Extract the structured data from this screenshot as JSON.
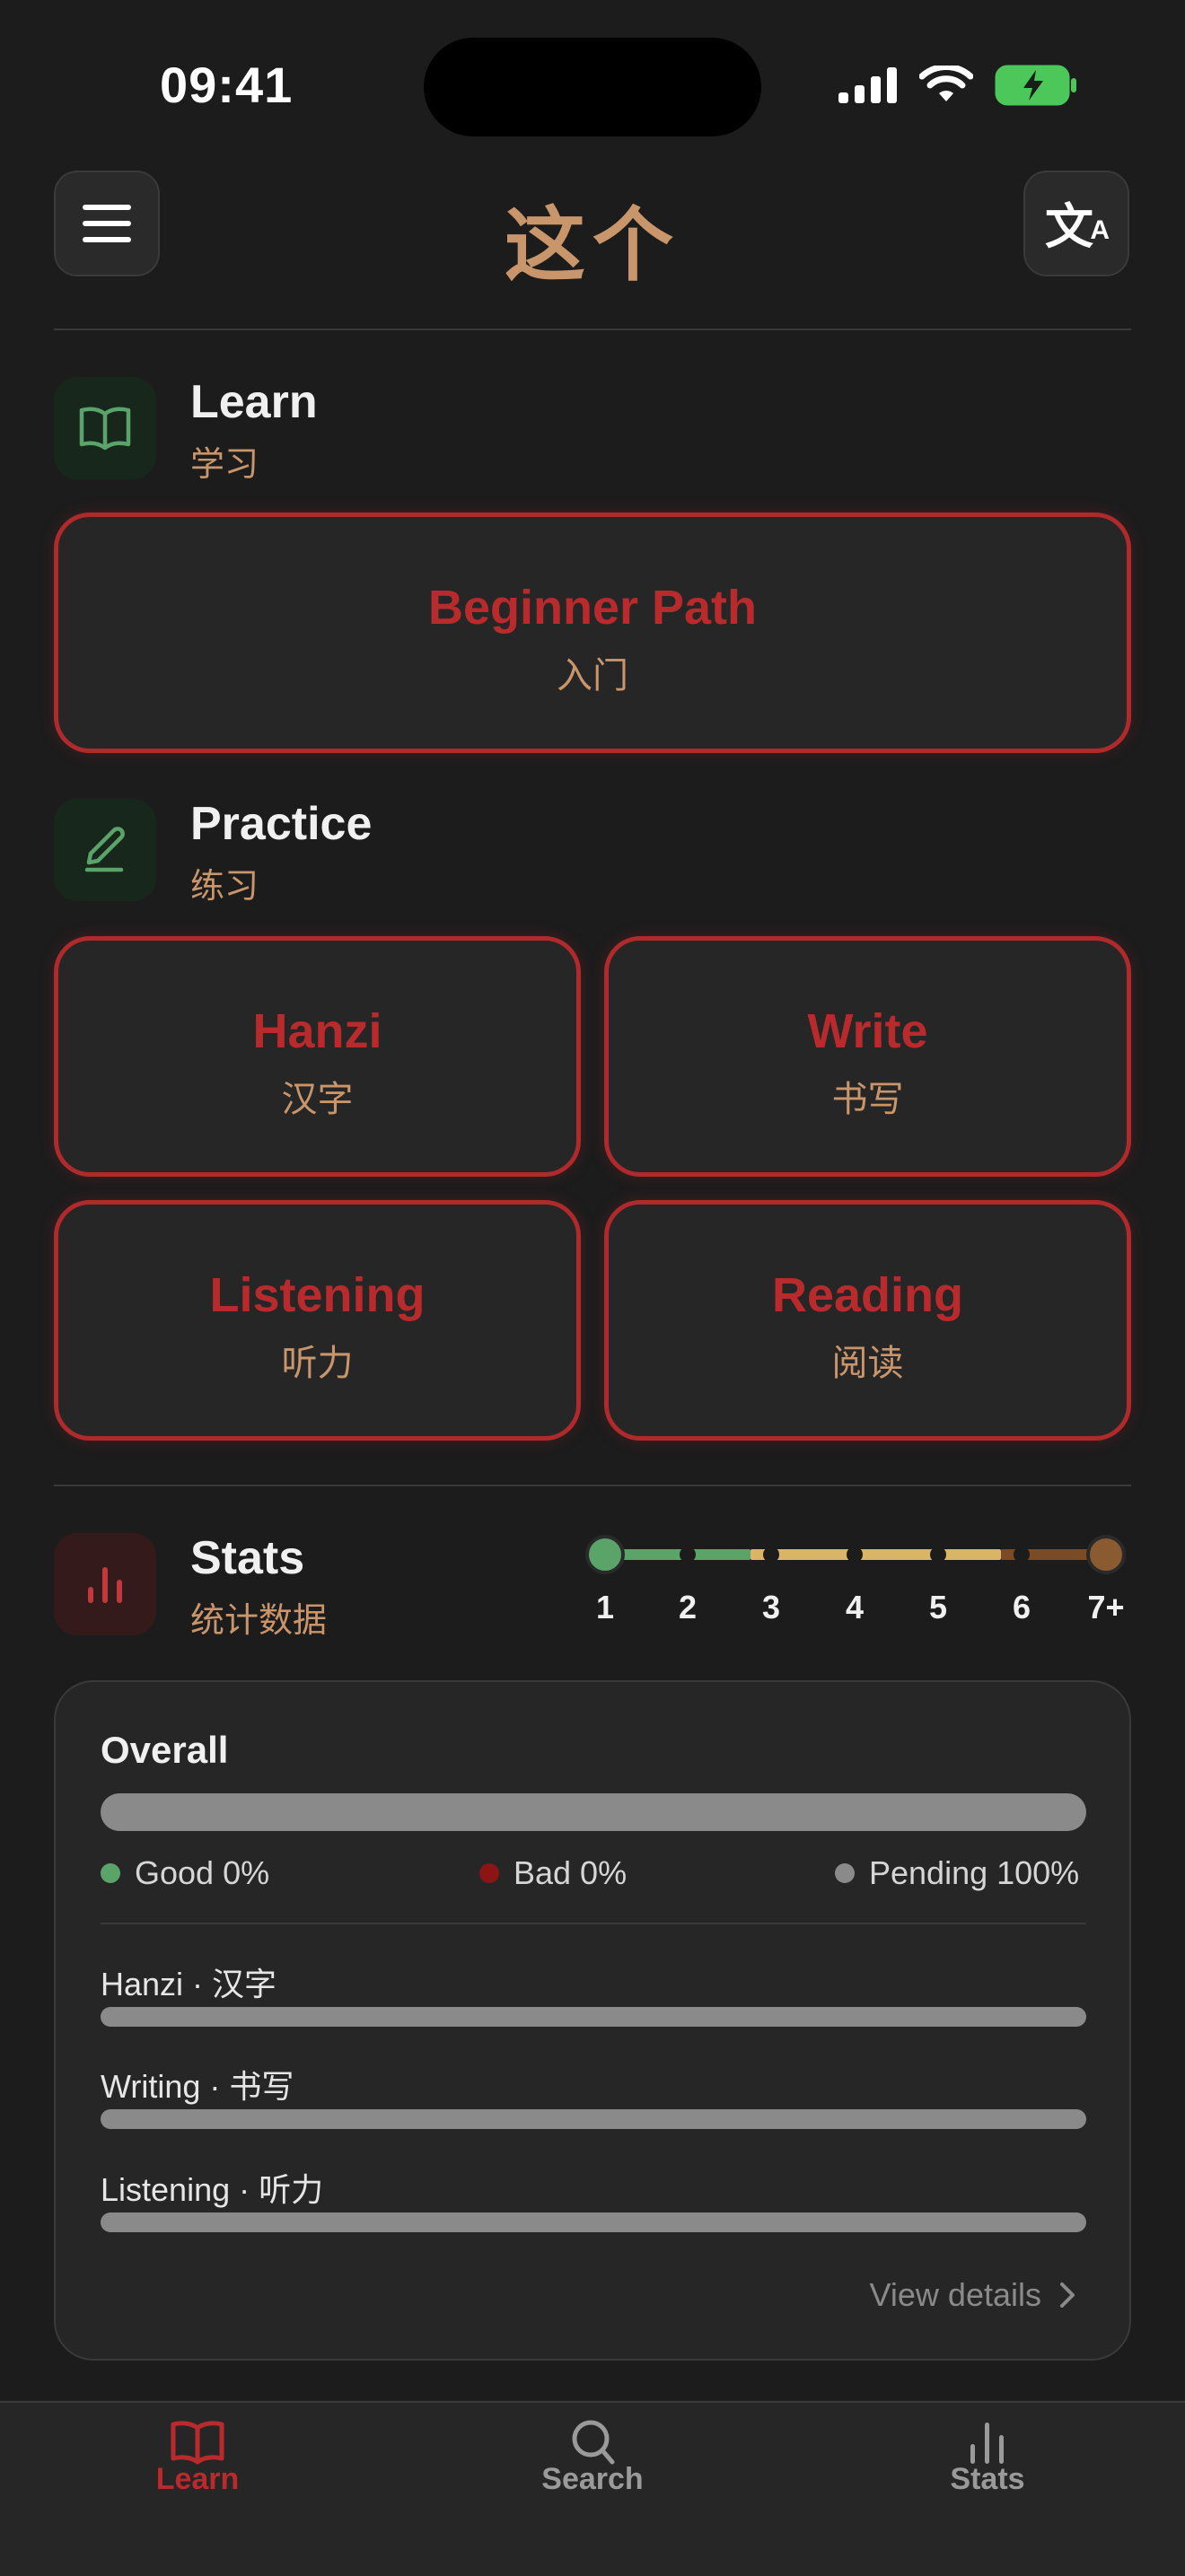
{
  "status_bar": {
    "time": "09:41",
    "icons": [
      "cellular-signal-icon",
      "wifi-icon",
      "battery-charging-icon"
    ]
  },
  "header": {
    "title": "这个",
    "menu_icon": "hamburger-menu-icon",
    "language_icon": "translate-icon",
    "language_glyph": "文",
    "language_glyph_sub": "A"
  },
  "learn": {
    "title": "Learn",
    "subtitle": "学习",
    "icon": "open-book-icon",
    "cards": [
      {
        "label": "Beginner Path",
        "sub": "入门"
      }
    ]
  },
  "practice": {
    "title": "Practice",
    "subtitle": "练习",
    "icon": "pencil-icon",
    "cards": [
      {
        "label": "Hanzi",
        "sub": "汉字"
      },
      {
        "label": "Write",
        "sub": "书写"
      },
      {
        "label": "Listening",
        "sub": "听力"
      },
      {
        "label": "Reading",
        "sub": "阅读"
      }
    ]
  },
  "stats": {
    "title": "Stats",
    "subtitle": "统计数据",
    "icon": "bar-chart-icon",
    "level_scale": {
      "labels": [
        "1",
        "2",
        "3",
        "4",
        "5",
        "6",
        "7+"
      ],
      "colors": {
        "start": "#5aa46a",
        "green": "#5aa46a",
        "yellow": "#d9b565",
        "brown": "#7a4b24",
        "end": "#8a5a30"
      }
    },
    "overall": {
      "title": "Overall",
      "good_fraction": 0.0,
      "bad_fraction": 0.0,
      "pending_fraction": 1.0,
      "legend": [
        {
          "label": "Good 0%",
          "color": "#5aa46a"
        },
        {
          "label": "Bad 0%",
          "color": "#8c1414"
        },
        {
          "label": "Pending 100%",
          "color": "#8a8a8a"
        }
      ]
    },
    "breakdown": [
      {
        "label": "Hanzi · 汉字",
        "good_fraction": 0.0,
        "bad_fraction": 0.0
      },
      {
        "label": "Writing · 书写",
        "good_fraction": 0.0,
        "bad_fraction": 0.0
      },
      {
        "label": "Listening · 听力",
        "good_fraction": 0.0,
        "bad_fraction": 0.0
      }
    ],
    "view_details": "View details"
  },
  "tab_bar": {
    "tabs": [
      {
        "label": "Learn",
        "icon": "open-book-icon",
        "active": true
      },
      {
        "label": "Search",
        "icon": "search-icon",
        "active": false
      },
      {
        "label": "Stats",
        "icon": "bar-chart-icon",
        "active": false
      }
    ]
  },
  "colors": {
    "accent_red": "#b82a2c",
    "accent_tan": "#c9956b",
    "good_green": "#5aa46a",
    "background": "#1c1c1d"
  }
}
